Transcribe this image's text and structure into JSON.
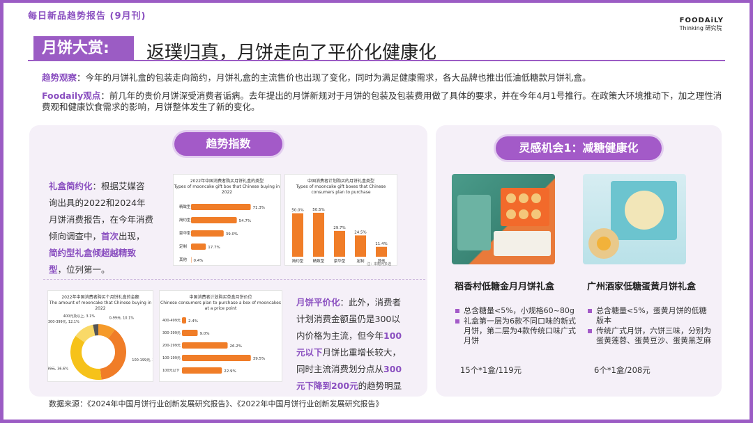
{
  "header": {
    "series_title": "每日新品趋势报告 (9月刊)",
    "logo_line1": "FOODAiLY",
    "logo_line2": "Thinking 研究院",
    "section_tag": "月饼大赏:",
    "headline": "返璞归真，月饼走向了平价化健康化"
  },
  "observation": {
    "label": "趋势观察",
    "text": "：今年的月饼礼盒的包装走向简约，月饼礼盒的主流售价也出现了变化，同时为满足健康需求，各大品牌也推出低油低糖款月饼礼盒。"
  },
  "viewpoint": {
    "label": "Foodaily观点",
    "text": "：前几年的贵价月饼深受消费者诟病。去年提出的月饼新规对于月饼的包装及包装费用做了具体的要求，并在今年4月1号推行。在政策大环境推动下，加之理性消费观和健康饮食需求的影响，月饼整体发生了新的变化。"
  },
  "left_panel": {
    "pill": "趋势指数",
    "para1": {
      "k1": "礼盒简约化",
      "t1": "：根据艾媒咨询出具的2022和2024年月饼消费报告，在今年消费倾向调查中，",
      "k2": "首次",
      "t2": "出现，",
      "k3": "简约型礼盒倾超越精致型",
      "t3": "，位列第一。"
    },
    "para2": {
      "k1": "月饼平价化",
      "t1": "：此外，消费者计划消费金额虽仍是300以内价格为主流，但今年",
      "k2": "100元以下",
      "t2": "月饼比重增长较大，同时主流消费划分点从",
      "k3": "300元下降到200元",
      "t3": "的趋势明显"
    }
  },
  "charts": {
    "c1": {
      "title_cn": "2022年中国消费者购买月饼礼盒的类型",
      "title_en": "Types of mooncake gift box that Chinese buying in 2022",
      "rows": [
        {
          "label": "精致型",
          "value": "71.3%"
        },
        {
          "label": "简约型",
          "value": "54.7%"
        },
        {
          "label": "豪华型",
          "value": "39.0%"
        },
        {
          "label": "定制",
          "value": "17.7%"
        },
        {
          "label": "其他",
          "value": "0.4%"
        }
      ]
    },
    "c2": {
      "title_cn": "中国消费者计划购买的月饼礼盒类型",
      "title_en": "Types of mooncake gift boxes that Chinese consumers plan to purchase",
      "categories": [
        "简约型",
        "精致型",
        "豪华型",
        "定制",
        "其他"
      ],
      "labels": [
        "50.0%",
        "50.5%",
        "29.7%",
        "24.5%",
        "11.4%"
      ],
      "note": "注：本题为多选"
    },
    "c3": {
      "title_cn": "2022年中国消费者购买个月饼礼盒的金额",
      "title_en": "The amount of mooncake that Chinese buying in 2022",
      "slices": [
        {
          "label": "0-99元, 10.1%",
          "value": 10.1
        },
        {
          "label": "100-199元, 38.1%",
          "value": 38.1
        },
        {
          "label": "200-299元, 36.6%",
          "value": 36.6
        },
        {
          "label": "300-399元, 12.1%",
          "value": 12.1
        },
        {
          "label": "400元及以上, 3.1%",
          "value": 3.1
        }
      ]
    },
    "c4": {
      "title_cn": "中国消费者计划购买单盒月饼价位",
      "title_en": "Chinese consumers plan to purchase a box of mooncakes at a price point",
      "rows": [
        {
          "label": "400-499元",
          "value": "2.4%"
        },
        {
          "label": "300-399元",
          "value": "9.0%"
        },
        {
          "label": "200-299元",
          "value": "26.2%"
        },
        {
          "label": "100-199元",
          "value": "39.5%"
        },
        {
          "label": "100元以下",
          "value": "22.9%"
        }
      ]
    }
  },
  "right_panel": {
    "pill": "灵感机会1：减糖健康化",
    "products": [
      {
        "name": "稻香村低糖金月月饼礼盒",
        "bullets": [
          "总含糖量<5%，小规格60~80g",
          "礼盒第一层为6款不同口味的新式月饼，第二层为4款传统口味广式月饼"
        ],
        "price": "15个*1盒/119元"
      },
      {
        "name": "广州酒家低糖蛋黄月饼礼盒",
        "bullets": [
          "总含糖量<5%，蛋黄月饼的低糖版本",
          "传统广式月饼，六饼三味，分别为蛋黄莲蓉、蛋黄豆沙、蛋黄黑芝麻"
        ],
        "price": "6个*1盒/208元"
      }
    ]
  },
  "source": "数据来源：《2024年中国月饼行业创新发展研究报告》、《2022年中国月饼行业创新发展研究报告》",
  "colors": {
    "accent": "#9b5cc4",
    "bar": "#f07d28",
    "panel": "#f5f0f8"
  }
}
